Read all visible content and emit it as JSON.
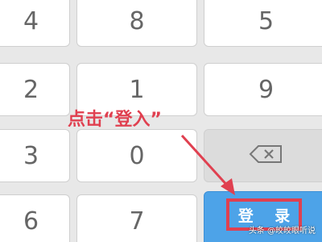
{
  "keypad": {
    "keys": {
      "k4": "4",
      "k8": "8",
      "k5": "5",
      "k2": "2",
      "k1": "1",
      "k9": "9",
      "k3": "3",
      "k0": "0",
      "k6": "6",
      "k7": "7"
    },
    "confirm_label": "登 录"
  },
  "annotation": {
    "text": "点击“登入”"
  },
  "watermark": {
    "text": "头条 @皎皎眼听说"
  },
  "colors": {
    "annotation_red": "#e04050",
    "confirm_blue": "#4da3e8",
    "key_text": "#666666"
  },
  "icons": {
    "backspace": "backspace-icon",
    "arrow": "arrow-icon"
  }
}
